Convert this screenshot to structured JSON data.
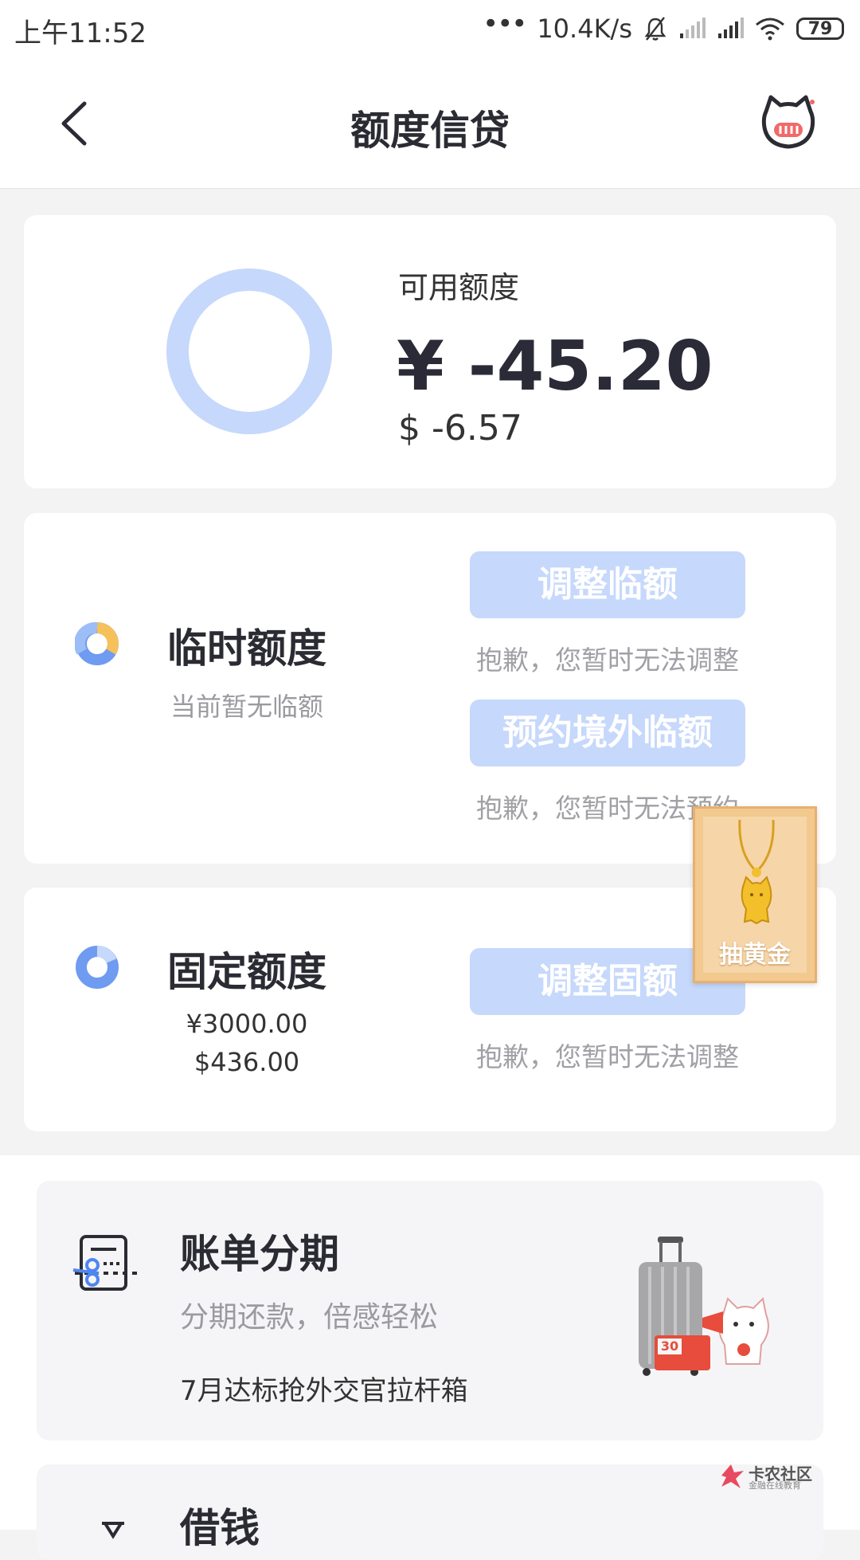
{
  "status_bar": {
    "time": "上午11:52",
    "dots": "•••",
    "speed": "10.4K/s",
    "battery": "79"
  },
  "nav": {
    "title": "额度信贷"
  },
  "available": {
    "label": "可用额度",
    "cny": "¥ -45.20",
    "usd": "$ -6.57"
  },
  "temp_credit": {
    "title": "临时额度",
    "subtitle": "当前暂无临额",
    "buttons": [
      {
        "label": "调整临额",
        "note": "抱歉，您暂时无法调整"
      },
      {
        "label": "预约境外临额",
        "note": "抱歉，您暂时无法预约"
      }
    ]
  },
  "fixed_credit": {
    "title": "固定额度",
    "amount_cny": "¥3000.00",
    "amount_usd": "$436.00",
    "button": {
      "label": "调整固额",
      "note": "抱歉，您暂时无法调整"
    }
  },
  "gold_float": {
    "label": "抽黄金"
  },
  "bill_installment": {
    "title": "账单分期",
    "subtitle": "分期还款，倍感轻松",
    "promo": "7月达标抢外交官拉杆箱",
    "badge": "30"
  },
  "borrow": {
    "title": "借钱"
  },
  "watermark": {
    "main": "卡农社区",
    "sub": "金融在线教育"
  },
  "colors": {
    "accent_light": "#c6d8fb",
    "accent": "#6f9bf0",
    "pie_orange": "#f6c15a",
    "background": "#f3f3f4",
    "card": "#ffffff",
    "muted_text": "#a0a0a6"
  }
}
